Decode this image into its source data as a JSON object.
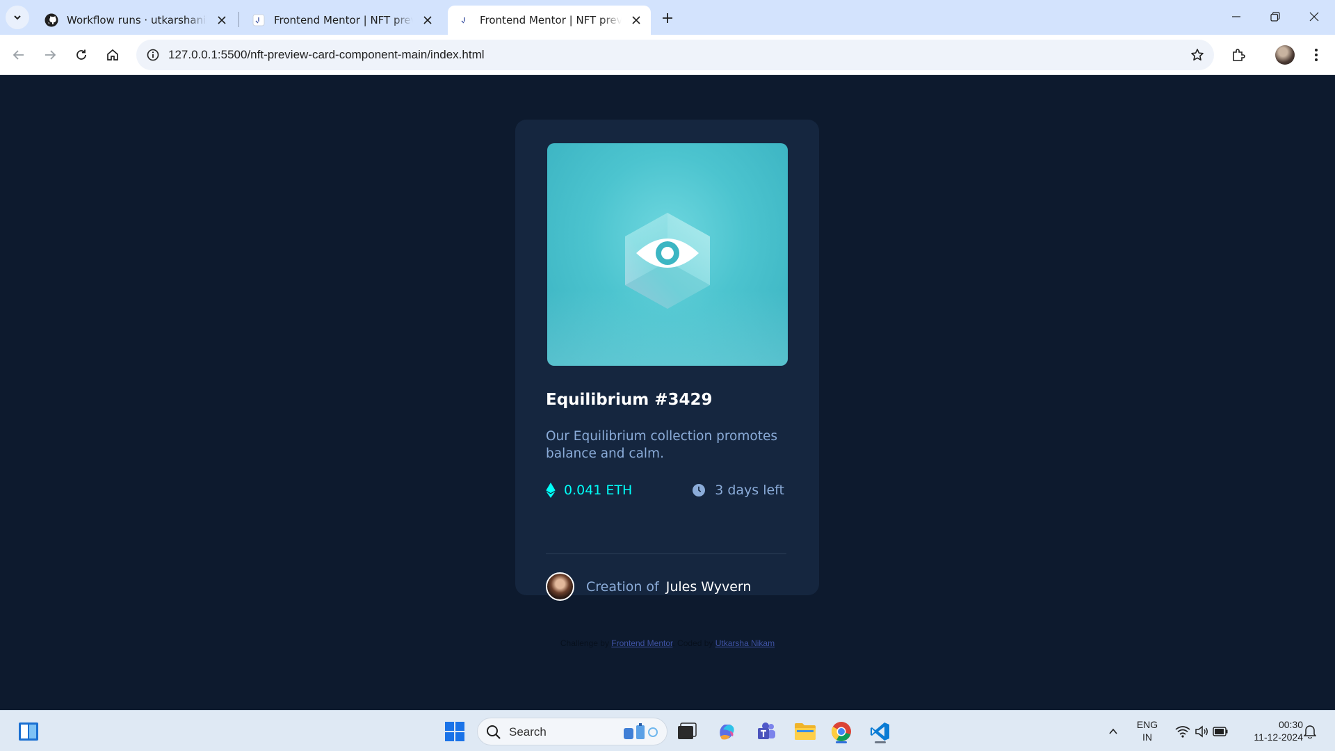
{
  "browser": {
    "tabs": [
      {
        "title": "Workflow runs · utkarshanik/Pre",
        "favicon": "github-icon",
        "active": false
      },
      {
        "title": "Frontend Mentor | NFT preview",
        "favicon": "frontend-mentor-icon",
        "active": false
      },
      {
        "title": "Frontend Mentor | NFT preview",
        "favicon": "frontend-mentor-icon",
        "active": true
      }
    ],
    "url": "127.0.0.1:5500/nft-preview-card-component-main/index.html"
  },
  "card": {
    "title": "Equilibrium #3429",
    "description": "Our Equilibrium collection promotes balance and calm.",
    "price": "0.041 ETH",
    "time_left": "3 days left",
    "creator_prefix": "Creation of",
    "creator_name": "Jules Wyvern",
    "colors": {
      "accent": "#00fff8",
      "muted": "#8bacd9",
      "card_bg": "#15263f",
      "page_bg": "#0d1a2e"
    }
  },
  "attribution": {
    "prefix": "Challenge by",
    "link1": "Frontend Mentor",
    "middle": ". Coded by",
    "link2": "Utkarsha Nikam"
  },
  "taskbar": {
    "search_placeholder": "Search",
    "lang_line1": "ENG",
    "lang_line2": "IN",
    "time": "00:30",
    "date": "11-12-2024"
  }
}
